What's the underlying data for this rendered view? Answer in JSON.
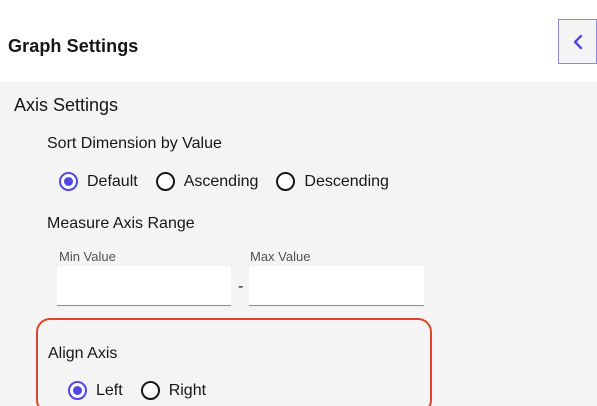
{
  "header": {
    "title": "Graph Settings",
    "collapse_icon": "chevron-left-icon"
  },
  "axis_settings": {
    "title": "Axis Settings",
    "sort": {
      "label": "Sort Dimension by Value",
      "options": [
        "Default",
        "Ascending",
        "Descending"
      ],
      "selected": "Default"
    },
    "measure_range": {
      "label": "Measure Axis Range",
      "min_label": "Min Value",
      "max_label": "Max Value",
      "min_value": "",
      "max_value": "",
      "separator": "-"
    },
    "align": {
      "label": "Align Axis",
      "options": [
        "Left",
        "Right"
      ],
      "selected": "Left"
    }
  },
  "colors": {
    "accent": "#4f46e5",
    "highlight": "#e0442a",
    "panel_bg": "#f4f4f4"
  }
}
